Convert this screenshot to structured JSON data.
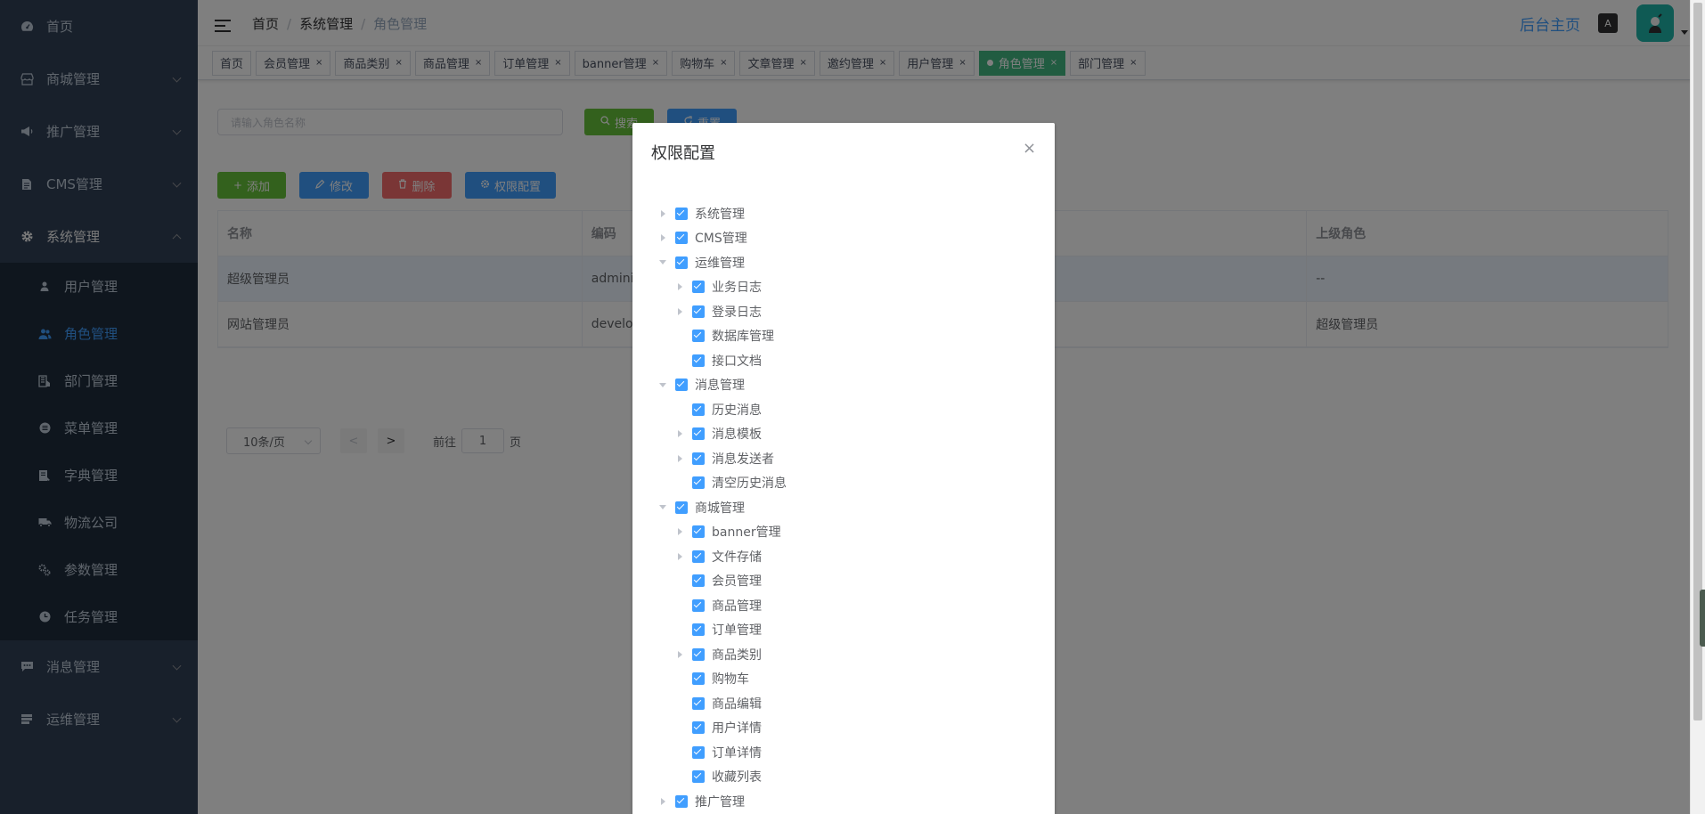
{
  "sidebar": {
    "items": [
      {
        "label": "首页",
        "icon": "dashboard-icon"
      },
      {
        "label": "商城管理",
        "icon": "shop-icon"
      },
      {
        "label": "推广管理",
        "icon": "megaphone-icon"
      },
      {
        "label": "CMS管理",
        "icon": "document-icon"
      },
      {
        "label": "系统管理",
        "icon": "gear-icon"
      },
      {
        "label": "消息管理",
        "icon": "message-icon"
      },
      {
        "label": "运维管理",
        "icon": "server-icon"
      }
    ],
    "sub_items": [
      {
        "label": "用户管理",
        "icon": "user-icon"
      },
      {
        "label": "角色管理",
        "icon": "users-icon"
      },
      {
        "label": "部门管理",
        "icon": "department-icon"
      },
      {
        "label": "菜单管理",
        "icon": "menu-icon"
      },
      {
        "label": "字典管理",
        "icon": "dictionary-icon"
      },
      {
        "label": "物流公司",
        "icon": "truck-icon"
      },
      {
        "label": "参数管理",
        "icon": "settings-icon"
      },
      {
        "label": "任务管理",
        "icon": "clock-icon"
      }
    ]
  },
  "header": {
    "breadcrumb": [
      "首页",
      "系统管理",
      "角色管理"
    ],
    "separator": "/",
    "home_link": "后台主页",
    "lang_icon_text": "A"
  },
  "tags": [
    "首页",
    "会员管理",
    "商品类别",
    "商品管理",
    "订单管理",
    "banner管理",
    "购物车",
    "文章管理",
    "邀约管理",
    "用户管理",
    "角色管理",
    "部门管理"
  ],
  "tag_close": "×",
  "toolbar": {
    "search_placeholder": "请输入角色名称",
    "search_label": "搜索",
    "reset_label": "重置",
    "add_label": "添加",
    "edit_label": "修改",
    "delete_label": "删除",
    "perm_label": "权限配置"
  },
  "table": {
    "headers": [
      "名称",
      "编码",
      "",
      "上级角色"
    ],
    "rows": [
      [
        "超级管理员",
        "adminis",
        "",
        "--"
      ],
      [
        "网站管理员",
        "develop",
        "",
        "超级管理员"
      ]
    ]
  },
  "pager": {
    "page_size": "10条/页",
    "prev": "<",
    "next": ">",
    "goto_label": "前往",
    "page": "1",
    "page_unit": "页"
  },
  "dialog": {
    "title": "权限配置",
    "close": "×",
    "tree": [
      {
        "label": "系统管理",
        "level": 0,
        "expand": "right"
      },
      {
        "label": "CMS管理",
        "level": 0,
        "expand": "right"
      },
      {
        "label": "运维管理",
        "level": 0,
        "expand": "down"
      },
      {
        "label": "业务日志",
        "level": 1,
        "expand": "right"
      },
      {
        "label": "登录日志",
        "level": 1,
        "expand": "right"
      },
      {
        "label": "数据库管理",
        "level": 1,
        "expand": ""
      },
      {
        "label": "接口文档",
        "level": 1,
        "expand": ""
      },
      {
        "label": "消息管理",
        "level": 0,
        "expand": "down"
      },
      {
        "label": "历史消息",
        "level": 1,
        "expand": ""
      },
      {
        "label": "消息模板",
        "level": 1,
        "expand": "right"
      },
      {
        "label": "消息发送者",
        "level": 1,
        "expand": "right"
      },
      {
        "label": "清空历史消息",
        "level": 1,
        "expand": ""
      },
      {
        "label": "商城管理",
        "level": 0,
        "expand": "down"
      },
      {
        "label": "banner管理",
        "level": 1,
        "expand": "right"
      },
      {
        "label": "文件存储",
        "level": 1,
        "expand": "right"
      },
      {
        "label": "会员管理",
        "level": 1,
        "expand": ""
      },
      {
        "label": "商品管理",
        "level": 1,
        "expand": ""
      },
      {
        "label": "订单管理",
        "level": 1,
        "expand": ""
      },
      {
        "label": "商品类别",
        "level": 1,
        "expand": "right"
      },
      {
        "label": "购物车",
        "level": 1,
        "expand": ""
      },
      {
        "label": "商品编辑",
        "level": 1,
        "expand": ""
      },
      {
        "label": "用户详情",
        "level": 1,
        "expand": ""
      },
      {
        "label": "订单详情",
        "level": 1,
        "expand": ""
      },
      {
        "label": "收藏列表",
        "level": 1,
        "expand": ""
      },
      {
        "label": "推广管理",
        "level": 0,
        "expand": "right"
      }
    ]
  },
  "colors": {
    "sidebar_bg": "#304156",
    "primary": "#409eff",
    "success": "#67c23a",
    "danger": "#f56c6c",
    "active_tag": "#42b983",
    "checkbox": "#409eff"
  }
}
